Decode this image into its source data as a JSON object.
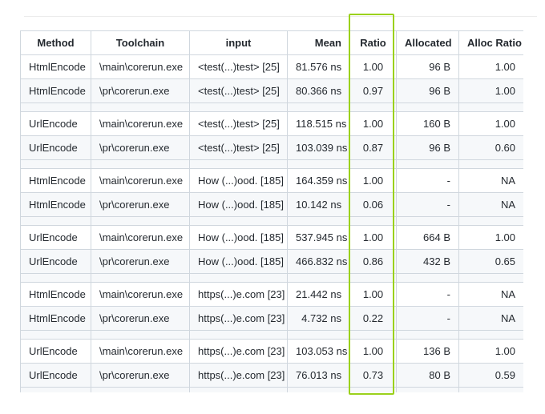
{
  "columns": [
    "Method",
    "Toolchain",
    "input",
    "Mean",
    "Ratio",
    "Allocated",
    "Alloc Ratio"
  ],
  "groups": [
    [
      [
        "HtmlEncode",
        "\\main\\corerun.exe",
        "<test(...)test> [25]",
        "81.576 ns",
        "1.00",
        "96 B",
        "1.00"
      ],
      [
        "HtmlEncode",
        "\\pr\\corerun.exe",
        "<test(...)test> [25]",
        "80.366 ns",
        "0.97",
        "96 B",
        "1.00"
      ]
    ],
    [
      [
        "UrlEncode",
        "\\main\\corerun.exe",
        "<test(...)test> [25]",
        "118.515 ns",
        "1.00",
        "160 B",
        "1.00"
      ],
      [
        "UrlEncode",
        "\\pr\\corerun.exe",
        "<test(...)test> [25]",
        "103.039 ns",
        "0.87",
        "96 B",
        "0.60"
      ]
    ],
    [
      [
        "HtmlEncode",
        "\\main\\corerun.exe",
        "How (...)ood. [185]",
        "164.359 ns",
        "1.00",
        "-",
        "NA"
      ],
      [
        "HtmlEncode",
        "\\pr\\corerun.exe",
        "How (...)ood. [185]",
        "10.142 ns",
        "0.06",
        "-",
        "NA"
      ]
    ],
    [
      [
        "UrlEncode",
        "\\main\\corerun.exe",
        "How (...)ood. [185]",
        "537.945 ns",
        "1.00",
        "664 B",
        "1.00"
      ],
      [
        "UrlEncode",
        "\\pr\\corerun.exe",
        "How (...)ood. [185]",
        "466.832 ns",
        "0.86",
        "432 B",
        "0.65"
      ]
    ],
    [
      [
        "HtmlEncode",
        "\\main\\corerun.exe",
        "https(...)e.com [23]",
        "21.442 ns",
        "1.00",
        "-",
        "NA"
      ],
      [
        "HtmlEncode",
        "\\pr\\corerun.exe",
        "https(...)e.com [23]",
        "4.732 ns",
        "0.22",
        "-",
        "NA"
      ]
    ],
    [
      [
        "UrlEncode",
        "\\main\\corerun.exe",
        "https(...)e.com [23]",
        "103.053 ns",
        "1.00",
        "136 B",
        "1.00"
      ],
      [
        "UrlEncode",
        "\\pr\\corerun.exe",
        "https(...)e.com [23]",
        "76.013 ns",
        "0.73",
        "80 B",
        "0.59"
      ]
    ]
  ],
  "colors": {
    "border": "#d0d7de",
    "stripe": "#f6f8fa",
    "highlight": "#9bd11c",
    "text": "#24292f"
  }
}
